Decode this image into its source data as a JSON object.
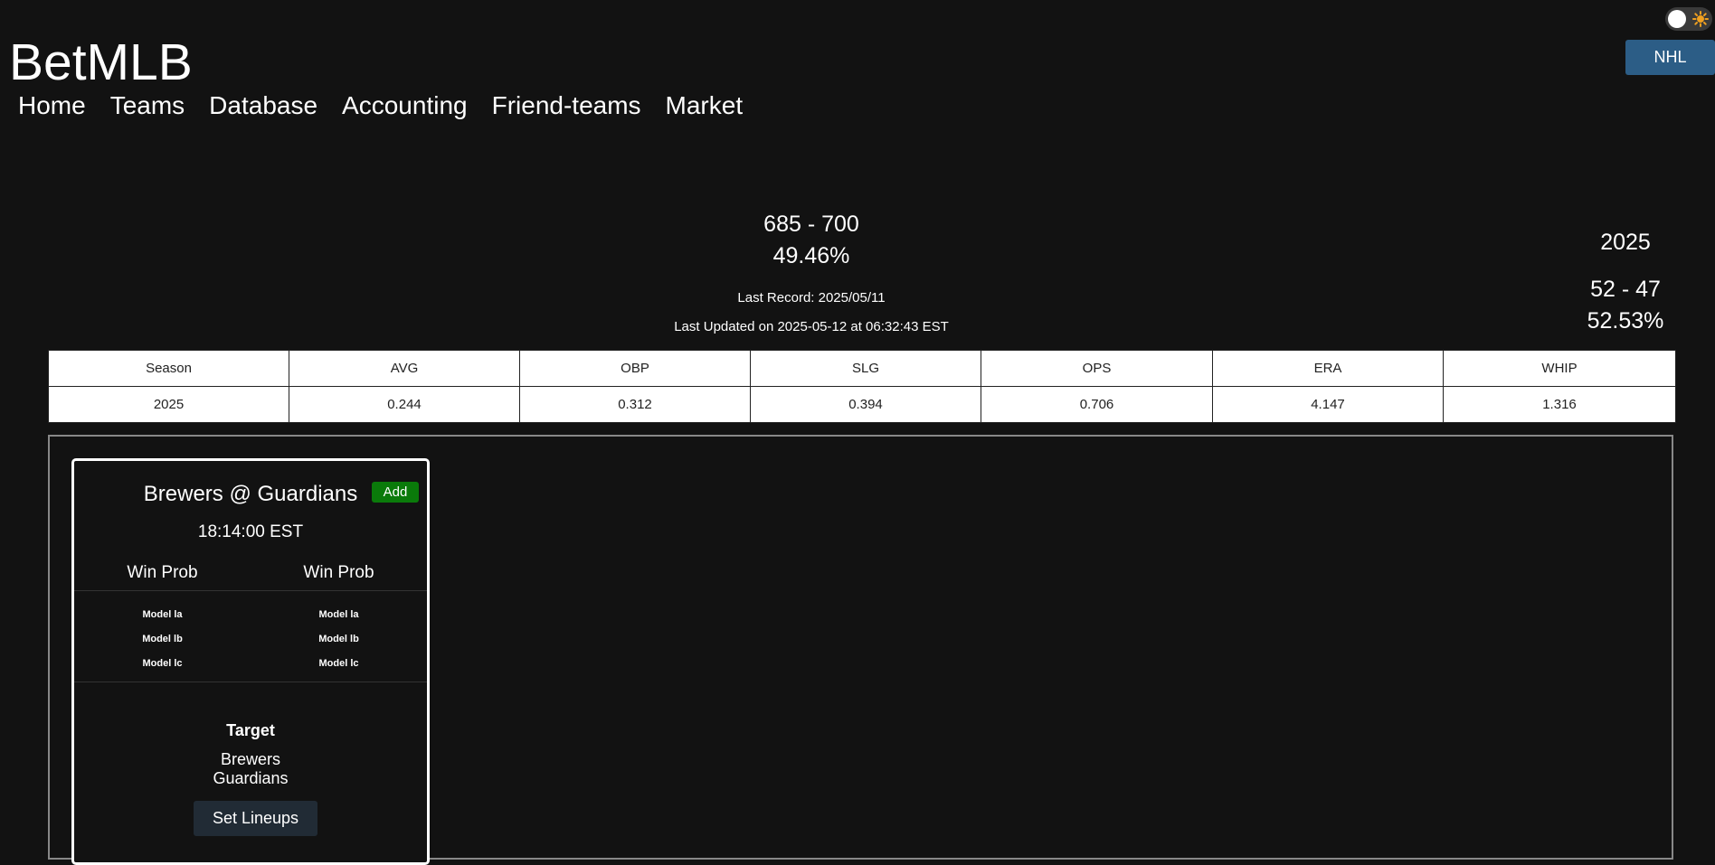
{
  "header": {
    "brand": "BetMLB",
    "nav": [
      "Home",
      "Teams",
      "Database",
      "Accounting",
      "Friend-teams",
      "Market"
    ],
    "theme_icon": "sun-icon",
    "nhl_label": "NHL"
  },
  "summary": {
    "record": "685 - 700",
    "win_pct": "49.46%",
    "last_record": "Last Record: 2025/05/11",
    "last_updated": "Last Updated on 2025-05-12 at 06:32:43 EST"
  },
  "season_summary": {
    "year": "2025",
    "record": "52 - 47",
    "win_pct": "52.53%"
  },
  "stats_table": {
    "headers": [
      "Season",
      "AVG",
      "OBP",
      "SLG",
      "OPS",
      "ERA",
      "WHIP"
    ],
    "rows": [
      [
        "2025",
        "0.244",
        "0.312",
        "0.394",
        "0.706",
        "4.147",
        "1.316"
      ]
    ]
  },
  "game": {
    "matchup": "Brewers @ Guardians",
    "add_label": "Add",
    "time": "18:14:00 EST",
    "away": {
      "prob_heading": "Win Prob",
      "models": [
        "Model la",
        "Model lb",
        "Model lc"
      ]
    },
    "home": {
      "prob_heading": "Win Prob",
      "models": [
        "Model la",
        "Model lb",
        "Model lc"
      ]
    },
    "target_heading": "Target",
    "target_teams": [
      "Brewers",
      "Guardians"
    ],
    "lineups_label": "Set Lineups"
  },
  "colors": {
    "background": "#121212",
    "nhl_button": "#2c5d86",
    "add_button": "#0a7a0a",
    "lineups_button": "#212b35"
  }
}
